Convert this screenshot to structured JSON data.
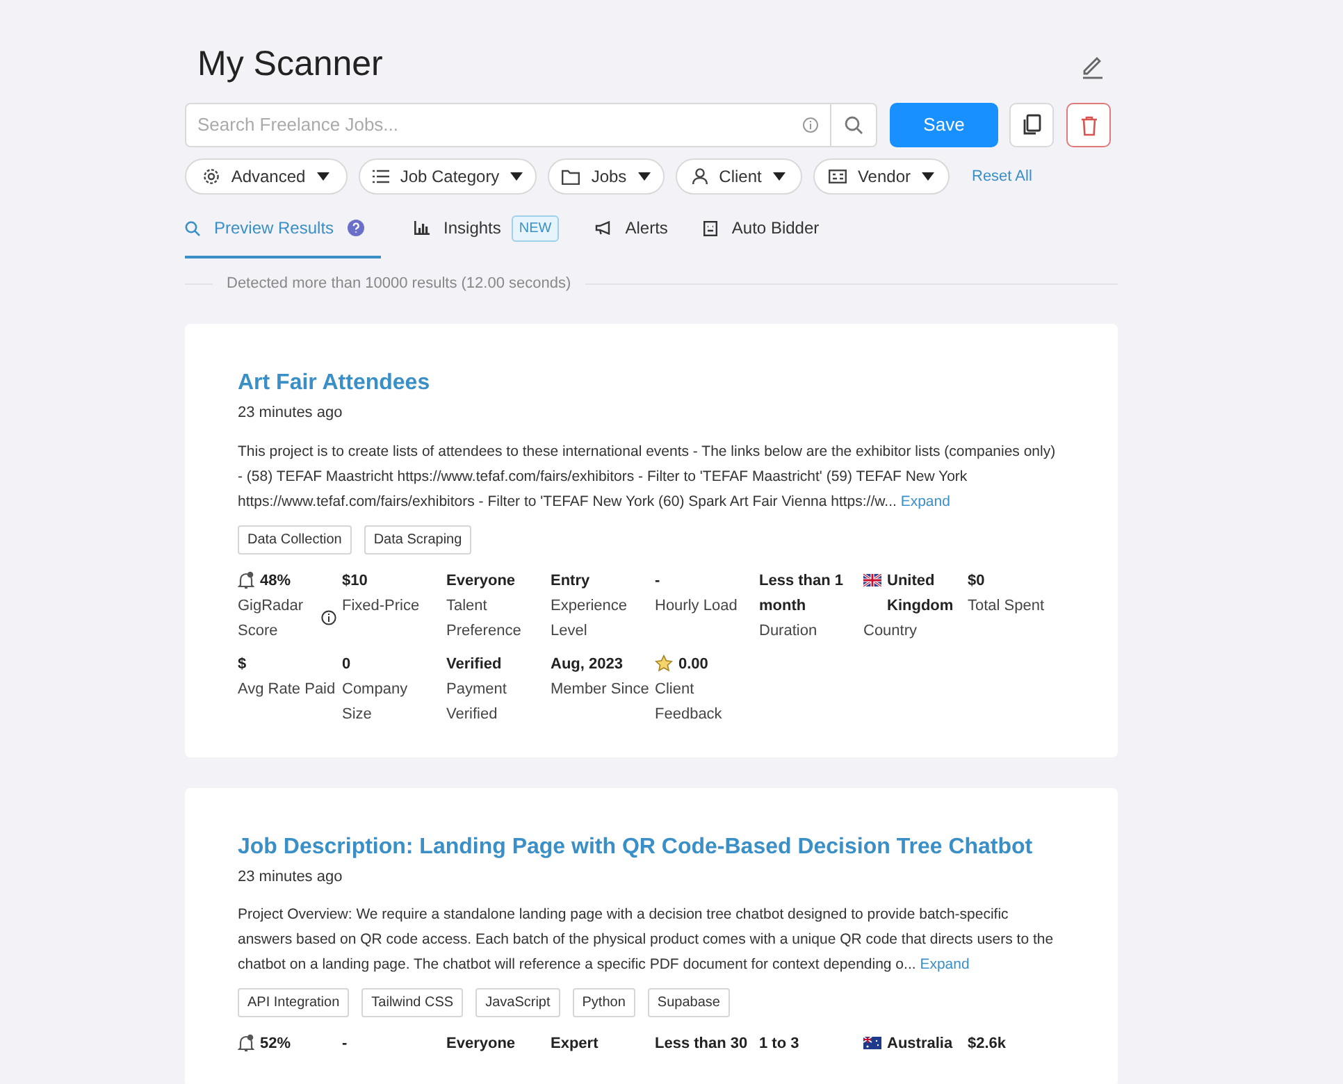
{
  "title": "My Scanner",
  "search": {
    "placeholder": "Search Freelance Jobs..."
  },
  "save_button": "Save",
  "filters": [
    "Advanced",
    "Job Category",
    "Jobs",
    "Client",
    "Vendor"
  ],
  "reset_link": "Reset All",
  "tabs": [
    {
      "label": "Preview Results",
      "selected": true
    },
    {
      "label": "Insights",
      "selected": false,
      "badge": "NEW"
    },
    {
      "label": "Alerts",
      "selected": false
    },
    {
      "label": "Auto Bidder",
      "selected": false
    }
  ],
  "results_summary": "Detected more than 10000 results (12.00 seconds)",
  "jobs": [
    {
      "title": "Art Fair Attendees",
      "posted": "23 minutes ago",
      "description": "This project is to create lists of attendees to these international events - The links below are the exhibitor lists (companies only) - (58) TEFAF Maastricht https://www.tefaf.com/fairs/exhibitors - Filter to 'TEFAF Maastricht' (59) TEFAF New York https://www.tefaf.com/fairs/exhibitors - Filter to 'TEFAF New York (60) Spark Art Fair Vienna https://w...",
      "expand": "Expand",
      "tags": [
        "Data Collection",
        "Data Scraping"
      ],
      "stats": [
        {
          "kind": "score",
          "value": "48%",
          "label": "GigRadar Score"
        },
        {
          "kind": "plain",
          "value": "$10",
          "label": "Fixed-Price"
        },
        {
          "kind": "plain",
          "value": "Everyone",
          "label": "Talent Preference"
        },
        {
          "kind": "plain",
          "value": "Entry",
          "label": "Experience Level"
        },
        {
          "kind": "plain",
          "value": "-",
          "label": "Hourly Load"
        },
        {
          "kind": "plain",
          "value": "Less than 1 month",
          "label": "Duration"
        },
        {
          "kind": "country_uk",
          "value": "United Kingdom",
          "label": "Country"
        },
        {
          "kind": "plain",
          "value": "$0",
          "label": "Total Spent"
        },
        {
          "kind": "plain",
          "value": "$",
          "label": "Avg Rate Paid"
        },
        {
          "kind": "plain",
          "value": "0",
          "label": "Company Size"
        },
        {
          "kind": "plain",
          "value": "Verified",
          "label": "Payment Verified"
        },
        {
          "kind": "plain",
          "value": "Aug, 2023",
          "label": "Member Since"
        },
        {
          "kind": "rating",
          "value": "0.00",
          "label": "Client Feedback"
        }
      ]
    },
    {
      "title": "Job Description: Landing Page with QR Code-Based Decision Tree Chatbot",
      "posted": "23 minutes ago",
      "description": "Project Overview: We require a standalone landing page with a decision tree chatbot designed to provide batch-specific answers based on QR code access. Each batch of the physical product comes with a unique QR code that directs users to the chatbot on a landing page. The chatbot will reference a specific PDF document for context depending o...",
      "expand": "Expand",
      "tags": [
        "API Integration",
        "Tailwind CSS",
        "JavaScript",
        "Python",
        "Supabase"
      ],
      "stats": [
        {
          "kind": "score",
          "value": "52%"
        },
        {
          "kind": "plain",
          "value": "-"
        },
        {
          "kind": "plain",
          "value": "Everyone"
        },
        {
          "kind": "plain",
          "value": "Expert"
        },
        {
          "kind": "plain",
          "value": "Less than 30"
        },
        {
          "kind": "plain",
          "value": "1 to 3"
        },
        {
          "kind": "country_au",
          "value": "Australia"
        },
        {
          "kind": "plain",
          "value": "$2.6k"
        }
      ]
    }
  ]
}
